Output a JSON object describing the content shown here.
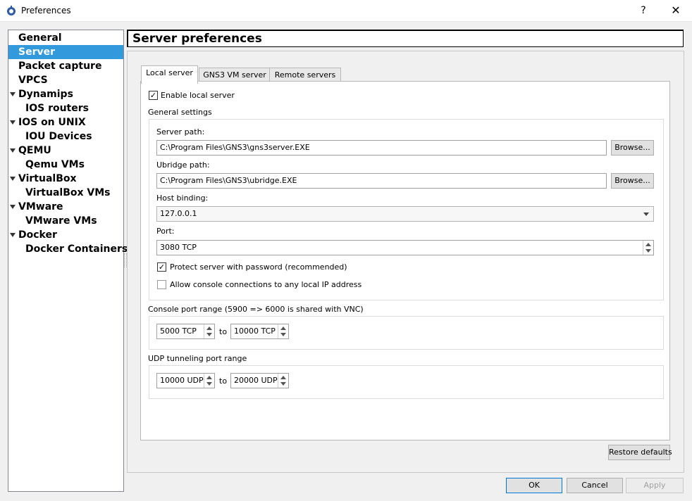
{
  "window": {
    "title": "Preferences",
    "help": "?",
    "close": "✕"
  },
  "sidebar": {
    "items": [
      {
        "label": "General",
        "indent": 0,
        "expandable": false,
        "selected": false
      },
      {
        "label": "Server",
        "indent": 0,
        "expandable": false,
        "selected": true
      },
      {
        "label": "Packet capture",
        "indent": 0,
        "expandable": false,
        "selected": false
      },
      {
        "label": "VPCS",
        "indent": 0,
        "expandable": false,
        "selected": false
      },
      {
        "label": "Dynamips",
        "indent": 0,
        "expandable": true,
        "selected": false
      },
      {
        "label": "IOS routers",
        "indent": 1,
        "expandable": false,
        "selected": false
      },
      {
        "label": "IOS on UNIX",
        "indent": 0,
        "expandable": true,
        "selected": false
      },
      {
        "label": "IOU Devices",
        "indent": 1,
        "expandable": false,
        "selected": false
      },
      {
        "label": "QEMU",
        "indent": 0,
        "expandable": true,
        "selected": false
      },
      {
        "label": "Qemu VMs",
        "indent": 1,
        "expandable": false,
        "selected": false
      },
      {
        "label": "VirtualBox",
        "indent": 0,
        "expandable": true,
        "selected": false
      },
      {
        "label": "VirtualBox VMs",
        "indent": 1,
        "expandable": false,
        "selected": false
      },
      {
        "label": "VMware",
        "indent": 0,
        "expandable": true,
        "selected": false
      },
      {
        "label": "VMware VMs",
        "indent": 1,
        "expandable": false,
        "selected": false
      },
      {
        "label": "Docker",
        "indent": 0,
        "expandable": true,
        "selected": false
      },
      {
        "label": "Docker Containers",
        "indent": 1,
        "expandable": false,
        "selected": false
      }
    ]
  },
  "header": {
    "title": "Server preferences"
  },
  "tabs": [
    {
      "label": "Local server",
      "active": true
    },
    {
      "label": "GNS3 VM server",
      "active": false
    },
    {
      "label": "Remote servers",
      "active": false
    }
  ],
  "local": {
    "enable_label": "Enable local server",
    "enable_checked": true,
    "general_settings": "General settings",
    "server_path_label": "Server path:",
    "server_path": "C:\\Program Files\\GNS3\\gns3server.EXE",
    "ubridge_path_label": "Ubridge path:",
    "ubridge_path": "C:\\Program Files\\GNS3\\ubridge.EXE",
    "browse": "Browse...",
    "host_binding_label": "Host binding:",
    "host_binding": "127.0.0.1",
    "port_label": "Port:",
    "port": "3080 TCP",
    "protect_label": "Protect server with password (recommended)",
    "protect_checked": true,
    "allow_label": "Allow console connections to any local IP address",
    "allow_checked": false,
    "console_range_label": "Console port range (5900 => 6000 is shared with VNC)",
    "console_from": "5000 TCP",
    "console_to": "10000 TCP",
    "to": "to",
    "udp_range_label": "UDP tunneling port range",
    "udp_from": "10000 UDP",
    "udp_to": "20000 UDP",
    "restore": "Restore defaults"
  },
  "buttons": {
    "ok": "OK",
    "cancel": "Cancel",
    "apply": "Apply"
  },
  "colors": {
    "selection": "#3399dd",
    "default_button_border": "#0078d7"
  }
}
